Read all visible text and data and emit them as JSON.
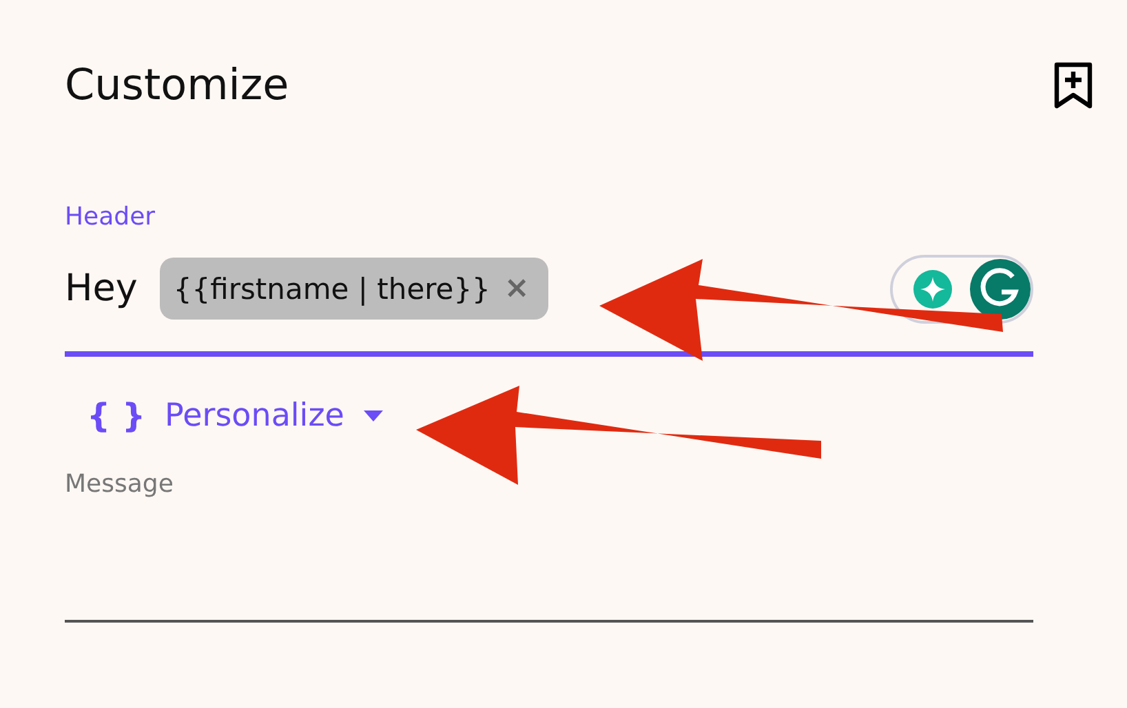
{
  "title": "Customize",
  "header_field": {
    "label": "Header",
    "prefix": "Hey",
    "token": {
      "text": "{{firstname | there}}",
      "remove": "×"
    }
  },
  "personalize": {
    "icon": "{ }",
    "label": "Personalize"
  },
  "message_field": {
    "label": "Message"
  }
}
